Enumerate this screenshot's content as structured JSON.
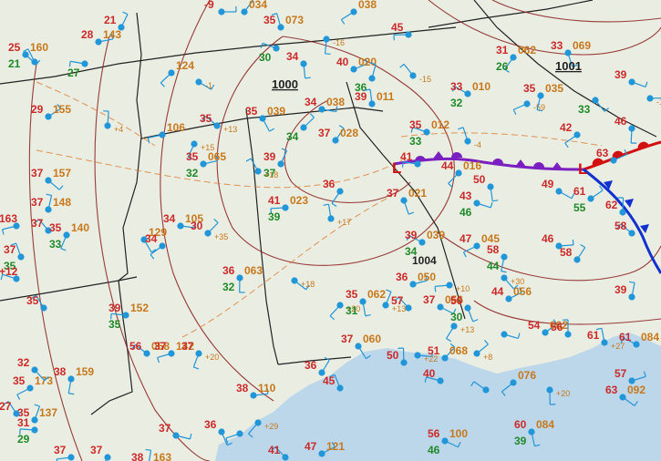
{
  "map": {
    "pressure_labels": [
      "1000",
      "1001",
      "1004"
    ],
    "low_marker": "L",
    "colors": {
      "land": "#e9ede2",
      "water": "#bcd6ea",
      "isobar": "#8b1c1c",
      "temperature": "#cc2a2a",
      "dewpoint": "#1f8a2a",
      "pressure": "#c8781a",
      "station": "#2196d8",
      "wind": "#2196d8",
      "weather": "#c020c0",
      "stationary_front": "#7a1fc0",
      "warm_front": "#d21010",
      "cold_front": "#1030d0",
      "border": "#222222"
    },
    "stations": [
      {
        "t": "-9",
        "d": "",
        "p": "",
        "tend": ""
      },
      {
        "t": "",
        "d": "",
        "p": "034",
        "tend": ""
      },
      {
        "t": "35",
        "d": "",
        "p": "073",
        "tend": ""
      },
      {
        "t": "",
        "d": "30",
        "p": "",
        "tend": ""
      },
      {
        "t": "",
        "d": "",
        "p": "038",
        "tend": ""
      },
      {
        "t": "",
        "d": "",
        "p": "",
        "tend": "-16"
      },
      {
        "t": "25",
        "d": "21",
        "p": "160",
        "tend": ""
      },
      {
        "t": "28",
        "d": "",
        "p": "143",
        "tend": ""
      },
      {
        "t": "21",
        "d": "",
        "p": "",
        "tend": ""
      },
      {
        "t": "",
        "d": "",
        "p": "",
        "tend": ""
      },
      {
        "t": "",
        "d": "27",
        "p": "",
        "tend": ""
      },
      {
        "t": "",
        "d": "",
        "p": "124",
        "tend": ""
      },
      {
        "t": "34",
        "d": "",
        "p": "",
        "tend": ""
      },
      {
        "t": "",
        "d": "",
        "p": "",
        "tend": "-1"
      },
      {
        "t": "40",
        "d": "",
        "p": "020",
        "tend": ""
      },
      {
        "t": "",
        "d": "36",
        "p": "",
        "tend": ""
      },
      {
        "t": "",
        "d": "",
        "p": "",
        "tend": "-15"
      },
      {
        "t": "45",
        "d": "",
        "p": "",
        "tend": ""
      },
      {
        "t": "31",
        "d": "26",
        "p": "062",
        "tend": ""
      },
      {
        "t": "33",
        "d": "",
        "p": "069",
        "tend": ""
      },
      {
        "t": "39",
        "d": "",
        "p": "",
        "tend": ""
      },
      {
        "t": "29",
        "d": "",
        "p": "155",
        "tend": ""
      },
      {
        "t": "",
        "d": "",
        "p": "",
        "tend": "+4"
      },
      {
        "t": "35",
        "d": "",
        "p": "",
        "tend": "+13"
      },
      {
        "t": "",
        "d": "",
        "p": "106",
        "tend": ""
      },
      {
        "t": "",
        "d": "",
        "p": "",
        "tend": "+15"
      },
      {
        "t": "35",
        "d": "",
        "p": "039",
        "tend": ""
      },
      {
        "t": "34",
        "d": "",
        "p": "038",
        "tend": ""
      },
      {
        "t": "",
        "d": "34",
        "p": "",
        "tend": ""
      },
      {
        "t": "39",
        "d": "",
        "p": "011",
        "tend": ""
      },
      {
        "t": "33",
        "d": "32",
        "p": "010",
        "tend": ""
      },
      {
        "t": "",
        "d": "",
        "p": "",
        "tend": "-59"
      },
      {
        "t": "35",
        "d": "",
        "p": "035",
        "tend": ""
      },
      {
        "t": "",
        "d": "33",
        "p": "",
        "tend": ""
      },
      {
        "t": "",
        "d": "",
        "p": "",
        "tend": "-1"
      },
      {
        "t": "37",
        "d": "",
        "p": "028",
        "tend": ""
      },
      {
        "t": "",
        "d": "",
        "p": "",
        "tend": "-4"
      },
      {
        "t": "35",
        "d": "33",
        "p": "012",
        "tend": ""
      },
      {
        "t": "42",
        "d": "",
        "p": "",
        "tend": ""
      },
      {
        "t": "46",
        "d": "",
        "p": "",
        "tend": ""
      },
      {
        "t": "37",
        "d": "",
        "p": "157",
        "tend": ""
      },
      {
        "t": "35",
        "d": "32",
        "p": "065",
        "tend": ""
      },
      {
        "t": "39",
        "d": "37",
        "p": "",
        "tend": ""
      },
      {
        "t": "",
        "d": "",
        "p": "",
        "tend": "+18"
      },
      {
        "t": "41",
        "d": "",
        "p": "",
        "tend": ""
      },
      {
        "t": "44",
        "d": "",
        "p": "016",
        "tend": ""
      },
      {
        "t": "50",
        "d": "",
        "p": "",
        "tend": ""
      },
      {
        "t": "49",
        "d": "",
        "p": "",
        "tend": ""
      },
      {
        "t": "63",
        "d": "",
        "p": "",
        "tend": ""
      },
      {
        "t": "37",
        "d": "",
        "p": "148",
        "tend": ""
      },
      {
        "t": "37",
        "d": "",
        "p": "",
        "tend": ""
      },
      {
        "t": "41",
        "d": "39",
        "p": "023",
        "tend": ""
      },
      {
        "t": "36",
        "d": "",
        "p": "",
        "tend": ""
      },
      {
        "t": "37",
        "d": "",
        "p": "021",
        "tend": ""
      },
      {
        "t": "43",
        "d": "46",
        "p": "",
        "tend": ""
      },
      {
        "t": "61",
        "d": "55",
        "p": "",
        "tend": ""
      },
      {
        "t": "62",
        "d": "",
        "p": "",
        "tend": ""
      },
      {
        "t": "58",
        "d": "",
        "p": "",
        "tend": ""
      },
      {
        "t": "163",
        "d": "",
        "p": "",
        "tend": ""
      },
      {
        "t": "35",
        "d": "33",
        "p": "140",
        "tend": ""
      },
      {
        "t": "",
        "d": "",
        "p": "129",
        "tend": ""
      },
      {
        "t": "34",
        "d": "",
        "p": "105",
        "tend": ""
      },
      {
        "t": "30",
        "d": "",
        "p": "",
        "tend": "+35"
      },
      {
        "t": "",
        "d": "",
        "p": "",
        "tend": "+17"
      },
      {
        "t": "39",
        "d": "34",
        "p": "039",
        "tend": ""
      },
      {
        "t": "47",
        "d": "",
        "p": "045",
        "tend": ""
      },
      {
        "t": "58",
        "d": "44",
        "p": "",
        "tend": ""
      },
      {
        "t": "",
        "d": "",
        "p": "",
        "tend": "+30"
      },
      {
        "t": "46",
        "d": "",
        "p": "",
        "tend": ""
      },
      {
        "t": "58",
        "d": "",
        "p": "",
        "tend": ""
      },
      {
        "t": "37",
        "d": "35",
        "p": "",
        "tend": ""
      },
      {
        "t": "+12",
        "d": "",
        "p": "",
        "tend": ""
      },
      {
        "t": "34",
        "d": "",
        "p": "",
        "tend": ""
      },
      {
        "t": "36",
        "d": "32",
        "p": "063",
        "tend": ""
      },
      {
        "t": "",
        "d": "",
        "p": "",
        "tend": "+18"
      },
      {
        "t": "36",
        "d": "",
        "p": "050",
        "tend": ""
      },
      {
        "t": "",
        "d": "",
        "p": "",
        "tend": "+13"
      },
      {
        "t": "35",
        "d": "",
        "p": "",
        "tend": ""
      },
      {
        "t": "39",
        "d": "35",
        "p": "152",
        "tend": ""
      },
      {
        "t": "",
        "d": "",
        "p": "",
        "tend": "+20"
      },
      {
        "t": "35",
        "d": "31",
        "p": "062",
        "tend": ""
      },
      {
        "t": "37",
        "d": "",
        "p": "056",
        "tend": ""
      },
      {
        "t": "44",
        "d": "",
        "p": "056",
        "tend": ""
      },
      {
        "t": "39",
        "d": "",
        "p": "",
        "tend": ""
      },
      {
        "t": "57",
        "d": "",
        "p": "",
        "tend": ""
      },
      {
        "t": "",
        "d": "",
        "p": "",
        "tend": "+10"
      },
      {
        "t": "",
        "d": "",
        "p": "",
        "tend": "+13"
      },
      {
        "t": "50",
        "d": "30",
        "p": "",
        "tend": ""
      },
      {
        "t": "",
        "d": "",
        "p": "",
        "tend": ""
      },
      {
        "t": "54",
        "d": "",
        "p": "062",
        "tend": ""
      },
      {
        "t": "56",
        "d": "",
        "p": "",
        "tend": ""
      },
      {
        "t": "56",
        "d": "",
        "p": "058",
        "tend": ""
      },
      {
        "t": "37",
        "d": "",
        "p": "142",
        "tend": ""
      },
      {
        "t": "37",
        "d": "",
        "p": "",
        "tend": "+20"
      },
      {
        "t": "37",
        "d": "",
        "p": "060",
        "tend": ""
      },
      {
        "t": "",
        "d": "",
        "p": "",
        "tend": "+22"
      },
      {
        "t": "51",
        "d": "",
        "p": "068",
        "tend": ""
      },
      {
        "t": "61",
        "d": "",
        "p": "",
        "tend": "+27"
      },
      {
        "t": "61",
        "d": "",
        "p": "084",
        "tend": ""
      },
      {
        "t": "35",
        "d": "",
        "p": "173",
        "tend": ""
      },
      {
        "t": "38",
        "d": "",
        "p": "159",
        "tend": ""
      },
      {
        "t": "32",
        "d": "",
        "p": "",
        "tend": ""
      },
      {
        "t": "38",
        "d": "",
        "p": "110",
        "tend": ""
      },
      {
        "t": "36",
        "d": "",
        "p": "",
        "tend": ""
      },
      {
        "t": "45",
        "d": "",
        "p": "",
        "tend": ""
      },
      {
        "t": "40",
        "d": "",
        "p": "",
        "tend": ""
      },
      {
        "t": "",
        "d": "",
        "p": "076",
        "tend": ""
      },
      {
        "t": "",
        "d": "",
        "p": "",
        "tend": "+20"
      },
      {
        "t": "63",
        "d": "",
        "p": "092",
        "tend": ""
      },
      {
        "t": "57",
        "d": "",
        "p": "",
        "tend": ""
      },
      {
        "t": "35",
        "d": "",
        "p": "137",
        "tend": ""
      },
      {
        "t": "27",
        "d": "",
        "p": "",
        "tend": ""
      },
      {
        "t": "31",
        "d": "29",
        "p": "",
        "tend": ""
      },
      {
        "t": "",
        "d": "",
        "p": "",
        "tend": "+29"
      },
      {
        "t": "60",
        "d": "39",
        "p": "084",
        "tend": ""
      },
      {
        "t": "56",
        "d": "46",
        "p": "100",
        "tend": ""
      },
      {
        "t": "47",
        "d": "",
        "p": "121",
        "tend": ""
      },
      {
        "t": "38",
        "d": "30",
        "p": "163",
        "tend": ""
      },
      {
        "t": "41",
        "d": "",
        "p": "",
        "tend": ""
      },
      {
        "t": "37",
        "d": "",
        "p": "",
        "tend": ""
      },
      {
        "t": "37",
        "d": "",
        "p": "",
        "tend": ""
      },
      {
        "t": "36",
        "d": "",
        "p": "",
        "tend": ""
      },
      {
        "t": "37",
        "d": "",
        "p": "",
        "tend": ""
      },
      {
        "t": "",
        "d": "",
        "p": "",
        "tend": "+8"
      },
      {
        "t": "50",
        "d": "",
        "p": "",
        "tend": ""
      },
      {
        "t": "",
        "d": "",
        "p": "",
        "tend": ""
      },
      {
        "t": "",
        "d": "",
        "p": "",
        "tend": ""
      }
    ]
  }
}
